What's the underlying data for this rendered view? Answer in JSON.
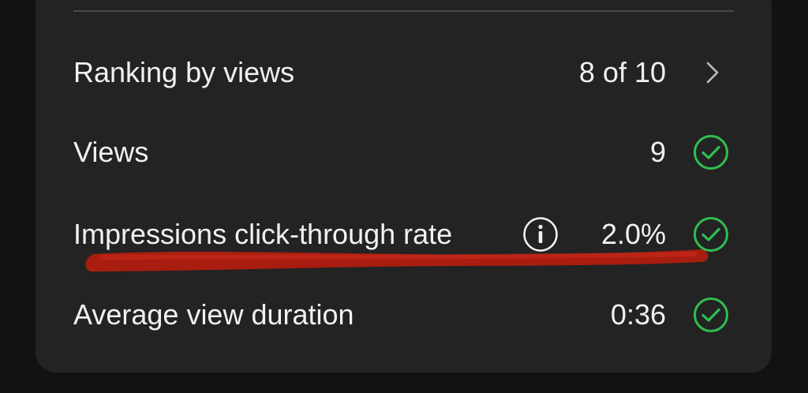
{
  "rows": [
    {
      "label": "Ranking by views",
      "value": "8 of 10",
      "icon": "chevron-right-icon"
    },
    {
      "label": "Views",
      "value": "9",
      "icon": "check-circle-icon"
    },
    {
      "label": "Impressions click-through rate",
      "value": "2.0%",
      "icon": "check-circle-icon",
      "has_info": true
    },
    {
      "label": "Average view duration",
      "value": "0:36",
      "icon": "check-circle-icon"
    }
  ],
  "colors": {
    "background": "#121212",
    "card": "#232323",
    "text": "#f1f1f1",
    "check_green": "#2fbf4f",
    "annotation_red": "#b01d10"
  }
}
